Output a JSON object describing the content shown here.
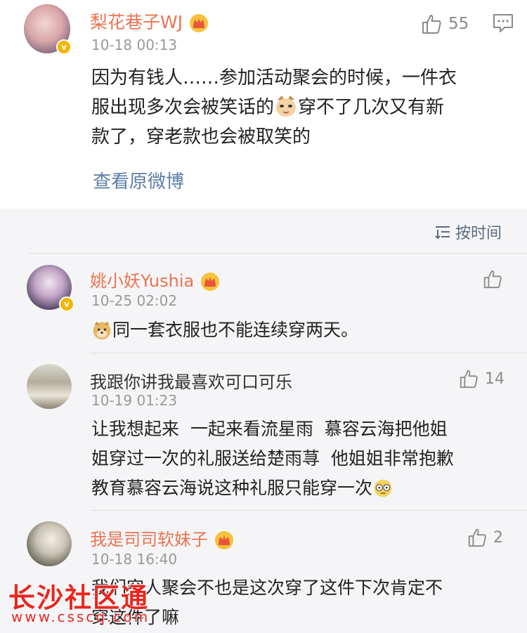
{
  "post": {
    "username": "梨花巷子WJ",
    "timestamp": "10-18 00:13",
    "likes": "55",
    "text_part1": "因为有钱人……参加活动聚会的时候，一件衣",
    "text_part2": "服出现多次会被笑话的",
    "text_part3": "穿不了几次又有新",
    "text_part4": "款了，穿老款也会被取笑的",
    "view_original": "查看原微博"
  },
  "sort": {
    "label": "按时间"
  },
  "comments": [
    {
      "username": "姚小妖Yushia",
      "timestamp": "10-25 02:02",
      "likes": "",
      "text": "同一套衣服也不能连续穿两天。"
    },
    {
      "username": "我跟你讲我最喜欢可口可乐",
      "timestamp": "10-19 01:23",
      "likes": "14",
      "line1": "让我想起来  一起来看流星雨  慕容云海把他姐",
      "line2": "姐穿过一次的礼服送给楚雨荨  他姐姐非常抱歉",
      "line3": "教育慕容云海说这种礼服只能穿一次"
    },
    {
      "username": "我是司司软妹子",
      "timestamp": "10-18 16:40",
      "likes": "2",
      "line1": "我们穷人聚会不也是这次穿了这件下次肯定不",
      "line2": "穿这件了嘛"
    }
  ],
  "watermark": {
    "title": "长沙社区通",
    "url": "www.csscq.com"
  },
  "colors": {
    "name_orange": "#eb7350",
    "time_grey": "#999999",
    "link_blue": "#5b7fa6",
    "grey_bg": "#f5f5f7",
    "watermark_red": "#e8271f"
  }
}
